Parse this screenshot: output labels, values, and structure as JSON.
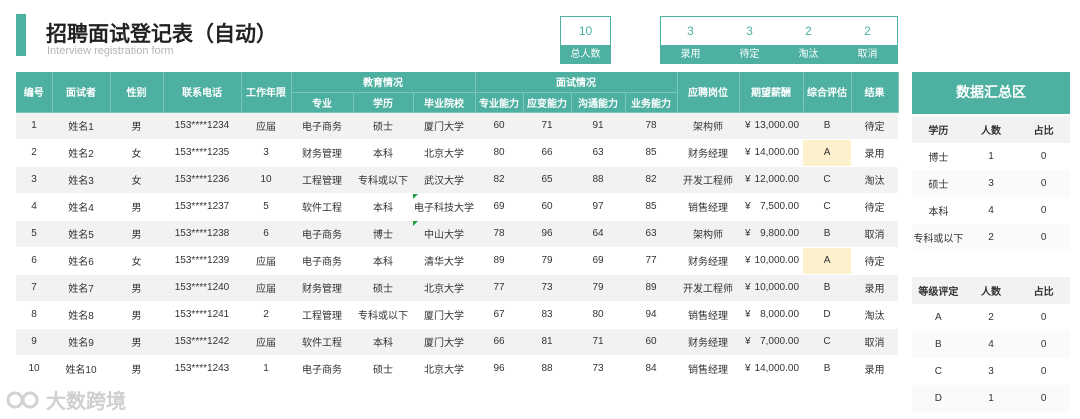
{
  "header": {
    "title": "招聘面试登记表（自动）",
    "subtitle": "Interview registration form"
  },
  "stats": {
    "total": {
      "value": "10",
      "label": "总人数"
    },
    "groups": [
      {
        "value": "3",
        "label": "录用"
      },
      {
        "value": "3",
        "label": "待定"
      },
      {
        "value": "2",
        "label": "淘汰"
      },
      {
        "value": "2",
        "label": "取消"
      }
    ]
  },
  "table": {
    "group_headers": {
      "education": "教育情况",
      "interview": "面试情况"
    },
    "headers": {
      "no": "编号",
      "name": "面试者",
      "gender": "性别",
      "phone": "联系电话",
      "years": "工作年限",
      "major": "专业",
      "degree": "学历",
      "school": "毕业院校",
      "skill": "专业能力",
      "react": "应变能力",
      "comm": "沟通能力",
      "biz": "业务能力",
      "position": "应聘岗位",
      "salary": "期望薪酬",
      "grade": "综合评估",
      "result": "结果"
    },
    "currency": "¥",
    "rows": [
      {
        "no": "1",
        "name": "姓名1",
        "gender": "男",
        "phone": "153****1234",
        "years": "应届",
        "major": "电子商务",
        "degree": "硕士",
        "school": "厦门大学",
        "skill": "60",
        "react": "71",
        "comm": "91",
        "biz": "78",
        "position": "架构师",
        "salary": "13,000.00",
        "grade": "B",
        "result": "待定"
      },
      {
        "no": "2",
        "name": "姓名2",
        "gender": "女",
        "phone": "153****1235",
        "years": "3",
        "major": "财务管理",
        "degree": "本科",
        "school": "北京大学",
        "skill": "80",
        "react": "66",
        "comm": "63",
        "biz": "85",
        "position": "财务经理",
        "salary": "14,000.00",
        "grade": "A",
        "result": "录用"
      },
      {
        "no": "3",
        "name": "姓名3",
        "gender": "女",
        "phone": "153****1236",
        "years": "10",
        "major": "工程管理",
        "degree": "专科或以下",
        "school": "武汉大学",
        "skill": "82",
        "react": "65",
        "comm": "88",
        "biz": "82",
        "position": "开发工程师",
        "salary": "12,000.00",
        "grade": "C",
        "result": "淘汰"
      },
      {
        "no": "4",
        "name": "姓名4",
        "gender": "男",
        "phone": "153****1237",
        "years": "5",
        "major": "软件工程",
        "degree": "本科",
        "school": "电子科技大学",
        "skill": "69",
        "react": "60",
        "comm": "97",
        "biz": "85",
        "position": "销售经理",
        "salary": "7,500.00",
        "grade": "C",
        "result": "待定"
      },
      {
        "no": "5",
        "name": "姓名5",
        "gender": "男",
        "phone": "153****1238",
        "years": "6",
        "major": "电子商务",
        "degree": "博士",
        "school": "中山大学",
        "skill": "78",
        "react": "96",
        "comm": "64",
        "biz": "63",
        "position": "架构师",
        "salary": "9,800.00",
        "grade": "B",
        "result": "取消"
      },
      {
        "no": "6",
        "name": "姓名6",
        "gender": "女",
        "phone": "153****1239",
        "years": "应届",
        "major": "电子商务",
        "degree": "本科",
        "school": "清华大学",
        "skill": "89",
        "react": "79",
        "comm": "69",
        "biz": "77",
        "position": "财务经理",
        "salary": "10,000.00",
        "grade": "A",
        "result": "待定"
      },
      {
        "no": "7",
        "name": "姓名7",
        "gender": "男",
        "phone": "153****1240",
        "years": "应届",
        "major": "财务管理",
        "degree": "硕士",
        "school": "北京大学",
        "skill": "77",
        "react": "73",
        "comm": "79",
        "biz": "89",
        "position": "开发工程师",
        "salary": "10,000.00",
        "grade": "B",
        "result": "录用"
      },
      {
        "no": "8",
        "name": "姓名8",
        "gender": "男",
        "phone": "153****1241",
        "years": "2",
        "major": "工程管理",
        "degree": "专科或以下",
        "school": "厦门大学",
        "skill": "67",
        "react": "83",
        "comm": "80",
        "biz": "94",
        "position": "销售经理",
        "salary": "8,000.00",
        "grade": "D",
        "result": "淘汰"
      },
      {
        "no": "9",
        "name": "姓名9",
        "gender": "男",
        "phone": "153****1242",
        "years": "应届",
        "major": "软件工程",
        "degree": "本科",
        "school": "厦门大学",
        "skill": "66",
        "react": "81",
        "comm": "71",
        "biz": "60",
        "position": "财务经理",
        "salary": "7,000.00",
        "grade": "C",
        "result": "取消"
      },
      {
        "no": "10",
        "name": "姓名10",
        "gender": "男",
        "phone": "153****1243",
        "years": "1",
        "major": "电子商务",
        "degree": "硕士",
        "school": "北京大学",
        "skill": "96",
        "react": "88",
        "comm": "73",
        "biz": "84",
        "position": "销售经理",
        "salary": "14,000.00",
        "grade": "B",
        "result": "录用"
      }
    ]
  },
  "summary": {
    "title": "数据汇总区",
    "degree_table": {
      "headers": [
        "学历",
        "人数",
        "占比"
      ],
      "rows": [
        [
          "博士",
          "1",
          "0"
        ],
        [
          "硕士",
          "3",
          "0"
        ],
        [
          "本科",
          "4",
          "0"
        ],
        [
          "专科或以下",
          "2",
          "0"
        ]
      ]
    },
    "grade_table": {
      "headers": [
        "等级评定",
        "人数",
        "占比"
      ],
      "rows": [
        [
          "A",
          "2",
          "0"
        ],
        [
          "B",
          "4",
          "0"
        ],
        [
          "C",
          "3",
          "0"
        ],
        [
          "D",
          "1",
          "0"
        ]
      ]
    }
  },
  "watermark": "大数跨境",
  "colors": {
    "accent": "#4db0a1",
    "highlight": "#fdf0cc",
    "marker": "#1e9b3c"
  }
}
